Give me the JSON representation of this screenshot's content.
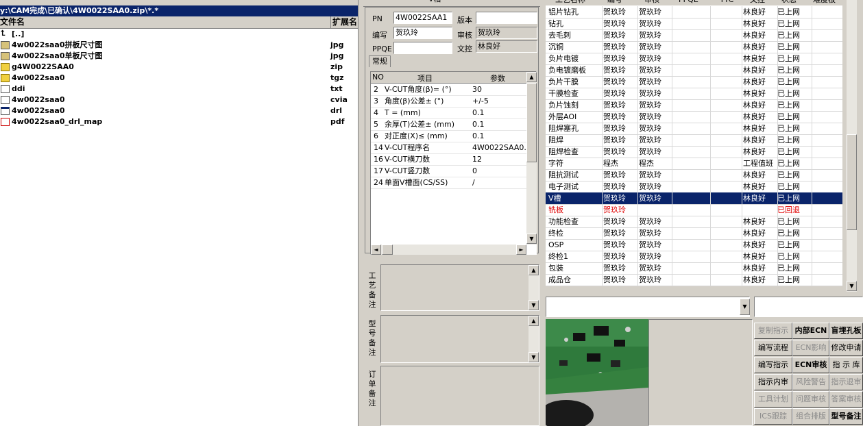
{
  "left": {
    "path": "y:\\CAM完成\\已确认\\4W0022SAA0.zip\\*.*",
    "columns": [
      "文件名",
      "扩展名"
    ],
    "files": [
      {
        "name": "[..]",
        "ext": "",
        "icon": "up-dir-icon"
      },
      {
        "name": "4w0022saa0拼板尺寸图",
        "ext": "jpg",
        "icon": "jpg-file-icon"
      },
      {
        "name": "4w0022saa0单板尺寸图",
        "ext": "jpg",
        "icon": "jpg-file-icon"
      },
      {
        "name": "g4W0022SAA0",
        "ext": "zip",
        "icon": "zip-file-icon"
      },
      {
        "name": "4w0022saa0",
        "ext": "tgz",
        "icon": "zip-file-icon"
      },
      {
        "name": "ddi",
        "ext": "txt",
        "icon": "text-file-icon"
      },
      {
        "name": "4w0022saa0",
        "ext": "cvia",
        "icon": "blank-file-icon"
      },
      {
        "name": "4w0022saa0",
        "ext": "drl",
        "icon": "drill-file-icon"
      },
      {
        "name": "4w0022saa0_drl_map",
        "ext": "pdf",
        "icon": "pdf-file-icon"
      }
    ]
  },
  "mid": {
    "title": "V槽",
    "fields": {
      "pn_label": "PN",
      "pn_value": "4W0022SAA1",
      "version_label": "版本",
      "version_value": "",
      "writer_label": "编写",
      "writer_value": "贺玖玲",
      "reviewer_label": "审核",
      "reviewer_value": "贺玖玲",
      "ppqe_label": "PPQE",
      "ppqe_value": "",
      "doc_label": "文控",
      "doc_value": "林良好"
    },
    "tab": "常规",
    "param_headers": [
      "NO",
      "项目",
      "参数"
    ],
    "params": [
      {
        "no": "2",
        "item": "V-CUT角度(β)=  (°)",
        "val": "30"
      },
      {
        "no": "3",
        "item": "角度(β)公差±  (°)",
        "val": "+/-5"
      },
      {
        "no": "4",
        "item": "T =  (mm)",
        "val": "0.1"
      },
      {
        "no": "5",
        "item": "余厚(T)公差±  (mm)",
        "val": "0.1"
      },
      {
        "no": "6",
        "item": "对正度(X)≤ (mm)",
        "val": "0.1"
      },
      {
        "no": "14",
        "item": "V-CUT程序名",
        "val": "4W0022SAA0.CS"
      },
      {
        "no": "16",
        "item": "V-CUT横刀数",
        "val": "12"
      },
      {
        "no": "17",
        "item": "V-CUT竖刀数",
        "val": "0"
      },
      {
        "no": "24",
        "item": "单面V槽面(CS/SS)",
        "val": "/"
      }
    ],
    "notes": [
      "工艺备注",
      "型号备注",
      "订单备注"
    ]
  },
  "right": {
    "headers": [
      "工艺名称",
      "编号",
      "审核",
      "PPQE",
      "TTC",
      "文控",
      "状态",
      "难度板"
    ],
    "rows": [
      [
        "铝片钻孔",
        "贺玖玲",
        "贺玖玲",
        "",
        "",
        "林良好",
        "已上网"
      ],
      [
        "钻孔",
        "贺玖玲",
        "贺玖玲",
        "",
        "",
        "林良好",
        "已上网"
      ],
      [
        "去毛刺",
        "贺玖玲",
        "贺玖玲",
        "",
        "",
        "林良好",
        "已上网"
      ],
      [
        "沉铜",
        "贺玖玲",
        "贺玖玲",
        "",
        "",
        "林良好",
        "已上网"
      ],
      [
        "负片电镀",
        "贺玖玲",
        "贺玖玲",
        "",
        "",
        "林良好",
        "已上网"
      ],
      [
        "负电镀磨板",
        "贺玖玲",
        "贺玖玲",
        "",
        "",
        "林良好",
        "已上网"
      ],
      [
        "负片干膜",
        "贺玖玲",
        "贺玖玲",
        "",
        "",
        "林良好",
        "已上网"
      ],
      [
        "干膜检查",
        "贺玖玲",
        "贺玖玲",
        "",
        "",
        "林良好",
        "已上网"
      ],
      [
        "负片蚀刻",
        "贺玖玲",
        "贺玖玲",
        "",
        "",
        "林良好",
        "已上网"
      ],
      [
        "外层AOI",
        "贺玖玲",
        "贺玖玲",
        "",
        "",
        "林良好",
        "已上网"
      ],
      [
        "阻焊塞孔",
        "贺玖玲",
        "贺玖玲",
        "",
        "",
        "林良好",
        "已上网"
      ],
      [
        "阻焊",
        "贺玖玲",
        "贺玖玲",
        "",
        "",
        "林良好",
        "已上网"
      ],
      [
        "阻焊检查",
        "贺玖玲",
        "贺玖玲",
        "",
        "",
        "林良好",
        "已上网"
      ],
      [
        "字符",
        "程杰",
        "程杰",
        "",
        "",
        "工程值班",
        "已上网"
      ],
      [
        "阻抗测试",
        "贺玖玲",
        "贺玖玲",
        "",
        "",
        "林良好",
        "已上网"
      ],
      [
        "电子测试",
        "贺玖玲",
        "贺玖玲",
        "",
        "",
        "林良好",
        "已上网"
      ],
      [
        "V槽",
        "贺玖玲",
        "贺玖玲",
        "",
        "",
        "林良好",
        "已上网"
      ],
      [
        "铣板",
        "贺玖玲",
        "",
        "",
        "",
        "",
        "已回退"
      ],
      [
        "功能检查",
        "贺玖玲",
        "贺玖玲",
        "",
        "",
        "林良好",
        "已上网"
      ],
      [
        "终检",
        "贺玖玲",
        "贺玖玲",
        "",
        "",
        "林良好",
        "已上网"
      ],
      [
        "OSP",
        "贺玖玲",
        "贺玖玲",
        "",
        "",
        "林良好",
        "已上网"
      ],
      [
        "终检1",
        "贺玖玲",
        "贺玖玲",
        "",
        "",
        "林良好",
        "已上网"
      ],
      [
        "包装",
        "贺玖玲",
        "贺玖玲",
        "",
        "",
        "林良好",
        "已上网"
      ],
      [
        "成品仓",
        "贺玖玲",
        "贺玖玲",
        "",
        "",
        "林良好",
        "已上网"
      ]
    ],
    "selected_row": 16,
    "red_row": 17,
    "buttons": [
      [
        {
          "label": "复制指示",
          "state": "dis"
        },
        {
          "label": "内部ECN",
          "state": "on"
        },
        {
          "label": "盲埋孔板",
          "state": "on"
        }
      ],
      [
        {
          "label": "编写流程",
          "state": ""
        },
        {
          "label": "ECN影响",
          "state": "dis"
        },
        {
          "label": "修改申请",
          "state": ""
        }
      ],
      [
        {
          "label": "编写指示",
          "state": ""
        },
        {
          "label": "ECN审核",
          "state": "on"
        },
        {
          "label": "指 示 库",
          "state": ""
        }
      ],
      [
        {
          "label": "指示内审",
          "state": ""
        },
        {
          "label": "风险警告",
          "state": "dis"
        },
        {
          "label": "指示退审",
          "state": "dis"
        }
      ],
      [
        {
          "label": "工具计划",
          "state": "dis"
        },
        {
          "label": "问题审核",
          "state": "dis"
        },
        {
          "label": "答案审核",
          "state": "dis"
        }
      ],
      [
        {
          "label": "ICS跟踪",
          "state": "dis"
        },
        {
          "label": "组合排版",
          "state": "dis"
        },
        {
          "label": "型号备注",
          "state": "on"
        }
      ]
    ]
  }
}
